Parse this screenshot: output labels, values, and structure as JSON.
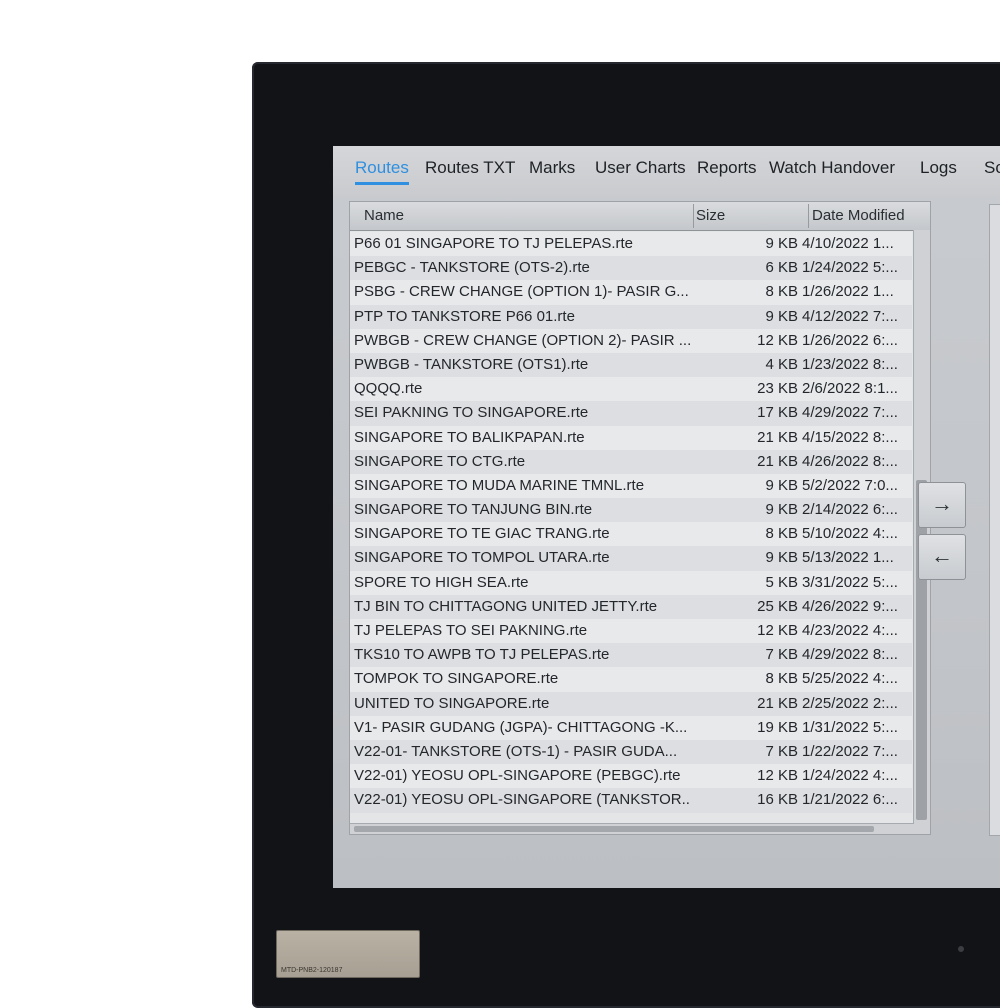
{
  "tabs": [
    {
      "label": "Routes",
      "active": true
    },
    {
      "label": "Routes TXT"
    },
    {
      "label": "Marks"
    },
    {
      "label": "User Charts"
    },
    {
      "label": "Reports"
    },
    {
      "label": "Watch Handover"
    },
    {
      "label": "Logs"
    },
    {
      "label": "Sc"
    }
  ],
  "columns": {
    "name": "Name",
    "size": "Size",
    "date": "Date Modified"
  },
  "rows": [
    {
      "name": "P66 01 SINGAPORE TO TJ PELEPAS.rte",
      "size": "9 KB",
      "date": "4/10/2022 1..."
    },
    {
      "name": "PEBGC - TANKSTORE (OTS-2).rte",
      "size": "6 KB",
      "date": "1/24/2022 5:..."
    },
    {
      "name": "PSBG - CREW CHANGE (OPTION 1)- PASIR G...",
      "size": "8 KB",
      "date": "1/26/2022 1..."
    },
    {
      "name": "PTP TO TANKSTORE P66 01.rte",
      "size": "9 KB",
      "date": "4/12/2022 7:..."
    },
    {
      "name": "PWBGB - CREW CHANGE (OPTION 2)- PASIR ...",
      "size": "12 KB",
      "date": "1/26/2022 6:..."
    },
    {
      "name": "PWBGB - TANKSTORE (OTS1).rte",
      "size": "4 KB",
      "date": "1/23/2022 8:..."
    },
    {
      "name": "QQQQ.rte",
      "size": "23 KB",
      "date": "2/6/2022 8:1..."
    },
    {
      "name": "SEI PAKNING TO SINGAPORE.rte",
      "size": "17 KB",
      "date": "4/29/2022 7:..."
    },
    {
      "name": "SINGAPORE TO BALIKPAPAN.rte",
      "size": "21 KB",
      "date": "4/15/2022 8:..."
    },
    {
      "name": "SINGAPORE TO CTG.rte",
      "size": "21 KB",
      "date": "4/26/2022 8:..."
    },
    {
      "name": "SINGAPORE TO MUDA MARINE TMNL.rte",
      "size": "9 KB",
      "date": "5/2/2022 7:0..."
    },
    {
      "name": "SINGAPORE TO TANJUNG BIN.rte",
      "size": "9 KB",
      "date": "2/14/2022 6:..."
    },
    {
      "name": "SINGAPORE TO TE GIAC TRANG.rte",
      "size": "8 KB",
      "date": "5/10/2022 4:..."
    },
    {
      "name": "SINGAPORE TO TOMPOL UTARA.rte",
      "size": "9 KB",
      "date": "5/13/2022 1..."
    },
    {
      "name": "SPORE TO HIGH SEA.rte",
      "size": "5 KB",
      "date": "3/31/2022 5:..."
    },
    {
      "name": "TJ BIN TO CHITTAGONG UNITED JETTY.rte",
      "size": "25 KB",
      "date": "4/26/2022 9:..."
    },
    {
      "name": "TJ PELEPAS TO SEI PAKNING.rte",
      "size": "12 KB",
      "date": "4/23/2022 4:..."
    },
    {
      "name": "TKS10 TO AWPB TO TJ PELEPAS.rte",
      "size": "7 KB",
      "date": "4/29/2022 8:..."
    },
    {
      "name": "TOMPOK TO SINGAPORE.rte",
      "size": "8 KB",
      "date": "5/25/2022 4:..."
    },
    {
      "name": "UNITED TO SINGAPORE.rte",
      "size": "21 KB",
      "date": "2/25/2022 2:..."
    },
    {
      "name": "V1- PASIR GUDANG (JGPA)- CHITTAGONG -K...",
      "size": "19 KB",
      "date": "1/31/2022 5:..."
    },
    {
      "name": "V22-01- TANKSTORE (OTS-1) - PASIR GUDA...",
      "size": "7 KB",
      "date": "1/22/2022 7:..."
    },
    {
      "name": "V22-01) YEOSU OPL-SINGAPORE (PEBGC).rte",
      "size": "12 KB",
      "date": "1/24/2022 4:..."
    },
    {
      "name": "V22-01) YEOSU OPL-SINGAPORE (TANKSTOR...",
      "size": "16 KB",
      "date": "1/21/2022 6:..."
    }
  ],
  "buttons": {
    "move_right": "→",
    "move_left": "←"
  },
  "plate": {
    "text": "MTD-PNB2-120187"
  }
}
